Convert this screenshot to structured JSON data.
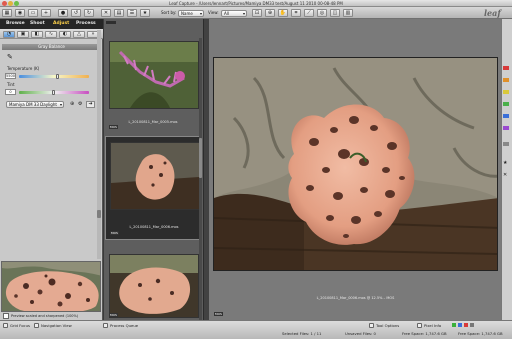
{
  "window": {
    "title": "Leaf Capture - /Users/lennart/Pictures/Mamiya DM33 test/August 11 2010 00-08-48 PM"
  },
  "toolbar": {
    "sort_label": "Sort by:",
    "sort_value": "Name",
    "filter_label": "View:",
    "filter_value": "All"
  },
  "logo": "leaf",
  "tabs": [
    {
      "label": "Browse",
      "active": false
    },
    {
      "label": "Shoot",
      "active": false
    },
    {
      "label": "Adjust",
      "active": true
    },
    {
      "label": "Process",
      "active": false
    }
  ],
  "gray_balance": {
    "title": "Gray Balance",
    "temperature_label": "Temperature (K)",
    "temperature_value": "5500",
    "tint_label": "Tint",
    "tint_value": "0",
    "preset": "Mamiya DM 33 Daylight"
  },
  "preview": {
    "checkbox_label": "Preview scaled and sharpened (100%)"
  },
  "thumbnails": [
    {
      "caption": "L_20100811_Mar_0005.mos",
      "badge": "MOS"
    },
    {
      "caption": "L_20100811_Mar_0006.mos",
      "badge": "MOS"
    },
    {
      "caption": "",
      "badge": "MOS"
    }
  ],
  "main_image": {
    "caption": "L_20100811_Mar_0006.mos @ 12.5% – MOS",
    "badge": "MOS"
  },
  "status": {
    "grid_focus": "Grid Focus",
    "navigation_view": "Navigation View",
    "process_queue": "Process Queue",
    "tool_options": "Tool Options",
    "pixel_info": "Pixel Info",
    "selected_files": "Selected Files: 1 / 11",
    "unsaved_files": "Unsaved Files: 0",
    "free_space_1": "Free Space: 1,747.6 GB",
    "free_space_2": "Free Space: 1,747.6 GB"
  },
  "colors": {
    "accent_tab": "#ffd24a",
    "slider_blue": "#4a8fe0",
    "slider_green": "#5fb04a"
  }
}
